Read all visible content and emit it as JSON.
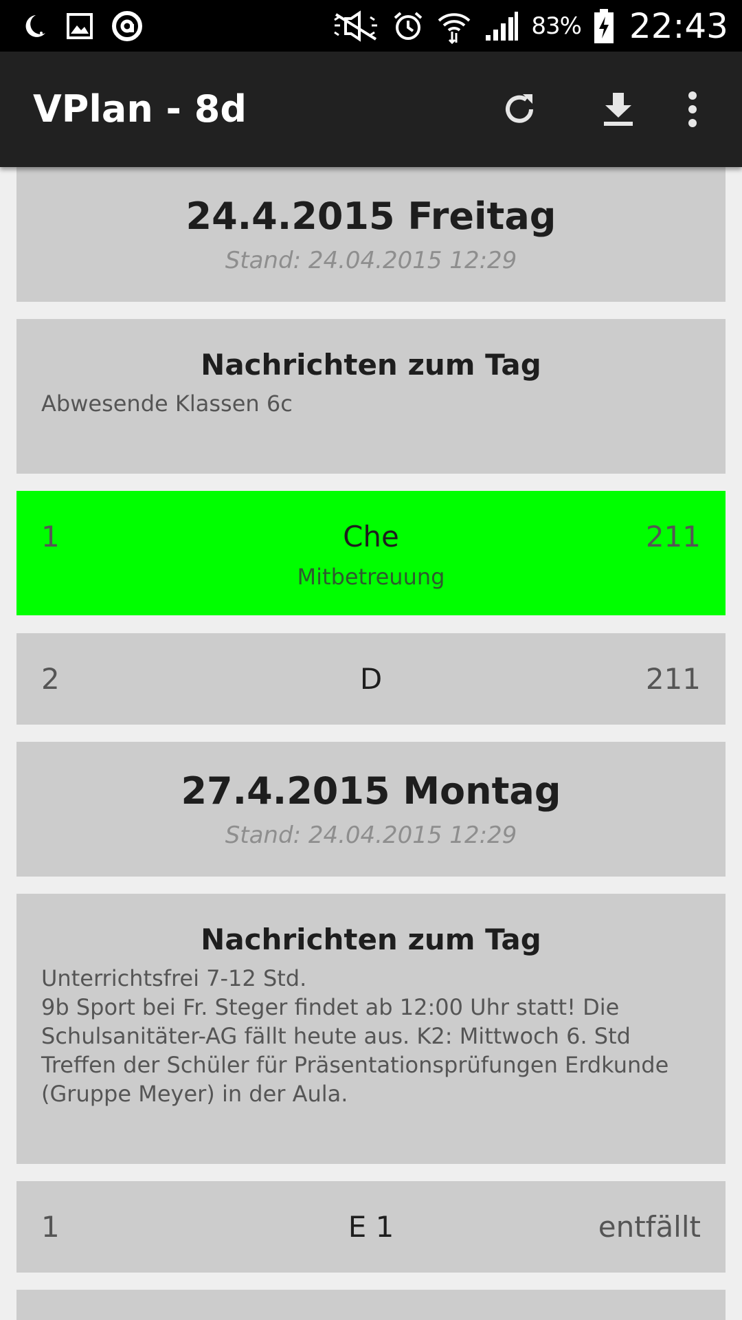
{
  "statusbar": {
    "battery_percent": "83%",
    "time": "22:43",
    "left_icons": [
      "moon-icon",
      "gallery-icon",
      "circle-app-icon"
    ],
    "right_icons": [
      "mute-icon",
      "alarm-icon",
      "wifi-icon",
      "signal-icon",
      "battery-charging-icon"
    ]
  },
  "appbar": {
    "title": "VPlan - 8d",
    "actions": [
      "refresh-icon",
      "download-icon",
      "overflow-menu-icon"
    ]
  },
  "colors": {
    "status_bar": "#000000",
    "app_bar": "#212121",
    "card": "#cccccc",
    "highlight": "#00ff00",
    "background": "#efefef"
  },
  "days": [
    {
      "title": "24.4.2015 Freitag",
      "stand": "Stand: 24.04.2015 12:29",
      "messages_title": "Nachrichten zum Tag",
      "messages": "Abwesende Klassen 6c",
      "rows": [
        {
          "hour": "1",
          "subject": "Che",
          "room": "211",
          "note": "Mitbetreuung",
          "highlight": true
        },
        {
          "hour": "2",
          "subject": "D",
          "room": "211",
          "note": "",
          "highlight": false
        }
      ]
    },
    {
      "title": "27.4.2015 Montag",
      "stand": "Stand: 24.04.2015 12:29",
      "messages_title": "Nachrichten zum Tag",
      "messages": "Unterrichtsfrei 7-12 Std.\n9b Sport bei Fr. Steger findet ab 12:00 Uhr statt! Die Schulsanitäter-AG fällt heute aus. K2: Mittwoch 6. Std Treffen der Schüler für Präsentationsprüfungen Erdkunde (Gruppe Meyer) in der Aula.",
      "rows": [
        {
          "hour": "1",
          "subject": "E 1",
          "room": "entfällt",
          "note": "",
          "highlight": false
        }
      ]
    }
  ]
}
